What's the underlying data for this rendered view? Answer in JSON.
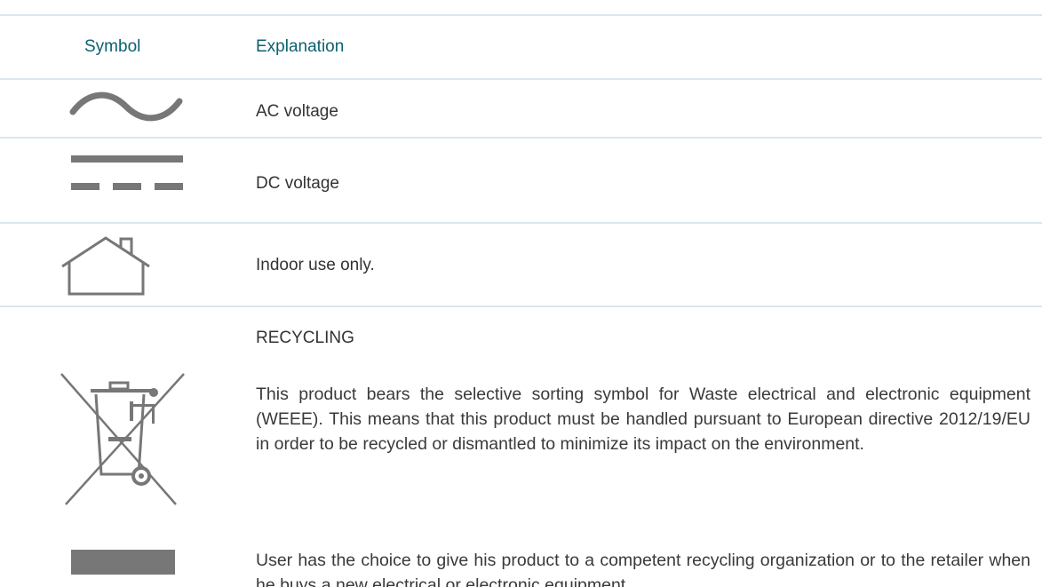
{
  "table": {
    "headers": [
      "Symbol",
      "Explanation"
    ],
    "rows": [
      {
        "icon": "ac-voltage-icon",
        "text": "AC voltage"
      },
      {
        "icon": "dc-voltage-icon",
        "text": "DC voltage"
      },
      {
        "icon": "indoor-use-house-icon",
        "text": "Indoor use only."
      },
      {
        "icon": "weee-crossed-bin-icon",
        "title": "RECYCLING",
        "paragraphs": [
          "This product bears the selective sorting symbol for Waste electrical and electronic equipment (WEEE). This means that this product must be handled pursuant to European directive 2012/19/EU in order to be recycled or dismantled to minimize its impact on the environment.",
          "User has the choice to give his product to a competent recycling organization or to the retailer when he buys a new electrical or electronic equipment."
        ]
      }
    ]
  },
  "colors": {
    "header_text": "#0b6270",
    "divider": "#d7e8ee",
    "icon_gray": "#777777",
    "body_text": "#333333"
  }
}
